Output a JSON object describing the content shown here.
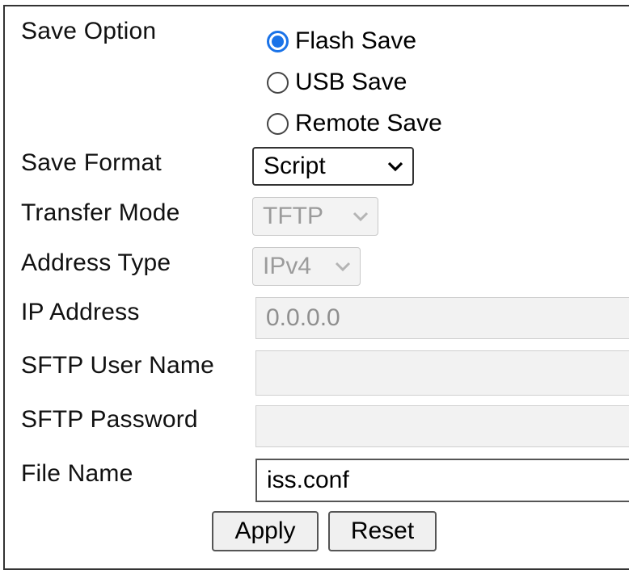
{
  "save_option": {
    "label": "Save Option",
    "options": [
      {
        "label": "Flash Save",
        "checked": true
      },
      {
        "label": "USB Save",
        "checked": false
      },
      {
        "label": "Remote Save",
        "checked": false
      }
    ]
  },
  "save_format": {
    "label": "Save Format",
    "value": "Script"
  },
  "transfer_mode": {
    "label": "Transfer Mode",
    "value": "TFTP"
  },
  "address_type": {
    "label": "Address Type",
    "value": "IPv4"
  },
  "ip_address": {
    "label": "IP Address",
    "value": "0.0.0.0"
  },
  "sftp_user_name": {
    "label": "SFTP User Name",
    "value": ""
  },
  "sftp_password": {
    "label": "SFTP Password",
    "value": ""
  },
  "file_name": {
    "label": "File Name",
    "value": "iss.conf"
  },
  "buttons": {
    "apply": "Apply",
    "reset": "Reset"
  },
  "colors": {
    "accent": "#1a73e8",
    "disabled_text": "#9b9b9b",
    "disabled_bg": "#f3f3f3"
  }
}
